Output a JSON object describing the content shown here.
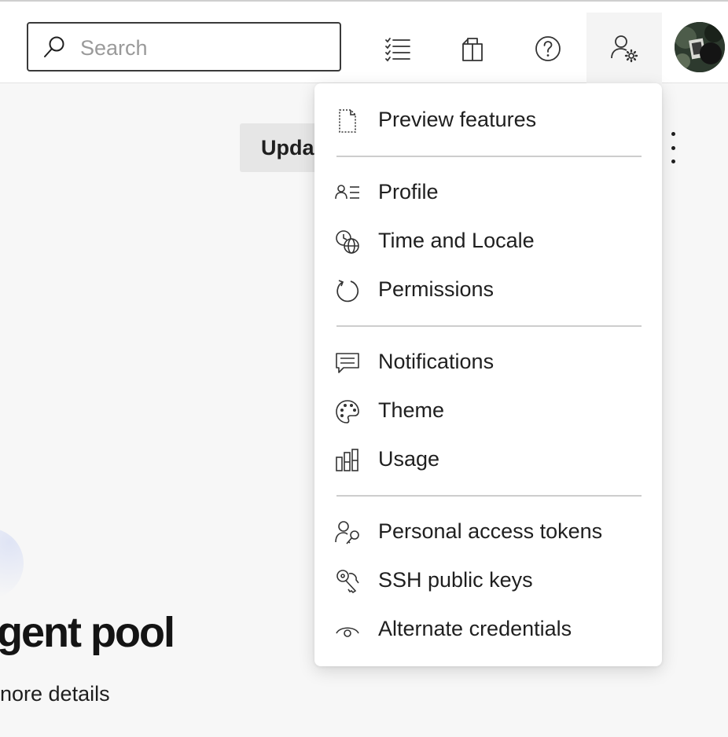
{
  "header": {
    "search_placeholder": "Search",
    "icons": [
      "task-list-icon",
      "marketplace-bag-icon",
      "help-icon",
      "user-settings-icon"
    ],
    "avatar": "user-avatar"
  },
  "page": {
    "update_button_label": "Upda",
    "more_options_icon": "vertical-ellipsis-icon",
    "title": "gent pool",
    "subtitle": "nore details"
  },
  "menu": {
    "group1": [
      {
        "label": "Preview features",
        "icon": "preview-doc-icon"
      }
    ],
    "group2": [
      {
        "label": "Profile",
        "icon": "profile-card-icon"
      },
      {
        "label": "Time and Locale",
        "icon": "clock-globe-icon"
      },
      {
        "label": "Permissions",
        "icon": "refresh-circle-icon"
      }
    ],
    "group3": [
      {
        "label": "Notifications",
        "icon": "chat-bubble-icon"
      },
      {
        "label": "Theme",
        "icon": "palette-icon"
      },
      {
        "label": "Usage",
        "icon": "bar-chart-icon"
      }
    ],
    "group4": [
      {
        "label": "Personal access tokens",
        "icon": "person-key-icon"
      },
      {
        "label": "SSH public keys",
        "icon": "keys-icon"
      },
      {
        "label": "Alternate credentials",
        "icon": "eye-icon"
      }
    ]
  },
  "colors": {
    "background": "#f7f7f7",
    "surface": "#ffffff",
    "text": "#1f1f1f",
    "placeholder": "#9a9a9a",
    "divider": "#cdcdcd"
  }
}
